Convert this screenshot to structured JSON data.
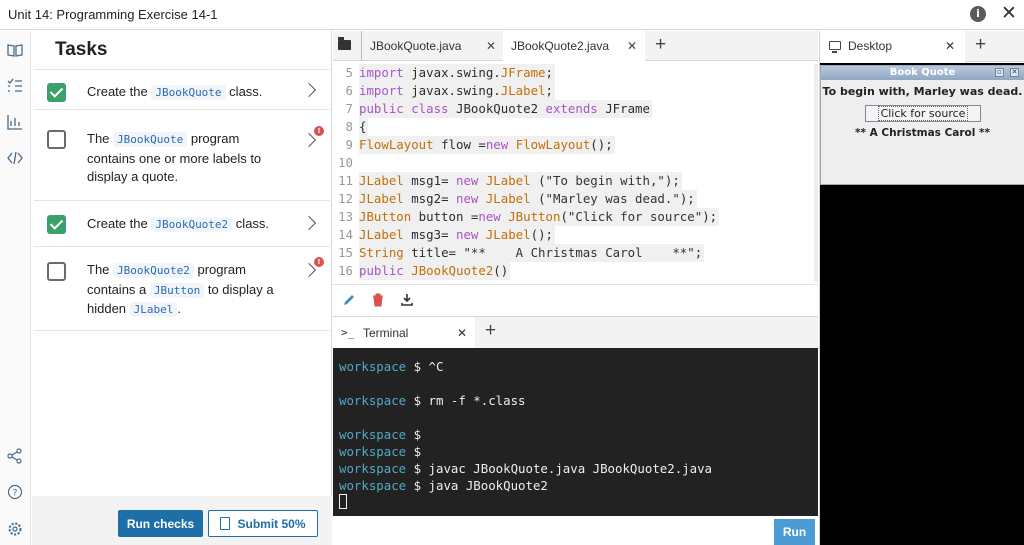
{
  "window": {
    "title": "Unit 14: Programming Exercise 14-1",
    "info_icon": "i",
    "close_icon": "✕"
  },
  "rail": {
    "icons": [
      "book-icon",
      "tasks-icon",
      "chart-icon",
      "code-icon",
      "share-icon",
      "help-icon",
      "settings-icon"
    ]
  },
  "tasks": {
    "heading": "Tasks",
    "items": [
      {
        "checked": true,
        "pre": "Create the ",
        "code1": "JBookQuote",
        "post": " class."
      },
      {
        "checked": false,
        "pre": "The ",
        "code1": "JBookQuote",
        "post": " program contains one or more labels to display a quote.",
        "badge": "!"
      },
      {
        "checked": true,
        "pre": "Create the ",
        "code1": "JBookQuote2",
        "post": " class."
      },
      {
        "checked": false,
        "pre": "The ",
        "code1": "JBookQuote2",
        "mid": " program contains a ",
        "code2": "JButton",
        "mid2": " to display a hidden ",
        "code3": "JLabel",
        "post": ".",
        "badge": "!"
      }
    ],
    "run_checks": "Run checks",
    "submit": "Submit 50%"
  },
  "editor": {
    "tabs": [
      {
        "label": "JBookQuote.java",
        "active": false
      },
      {
        "label": "JBookQuote2.java",
        "active": true
      }
    ],
    "lines": [
      {
        "n": "5",
        "html": "<span class='kw'>import</span><span class='pl'> javax.swing.</span><span class='ty'>JFrame</span><span class='pl'>;</span>"
      },
      {
        "n": "6",
        "html": "<span class='kw'>import</span><span class='pl'> javax.swing.</span><span class='ty'>JLabel</span><span class='pl'>;</span>"
      },
      {
        "n": "7",
        "html": "<span class='kw'>public class</span><span class='pl'> JBookQuote2 </span><span class='kw'>extends</span><span class='pl'> JFrame</span>"
      },
      {
        "n": "8",
        "html": "<span class='pl'>{</span>"
      },
      {
        "n": "9",
        "html": "<span class='ty'>FlowLayout</span><span class='pl'> flow =</span><span class='kw'>new</span><span class='pl'> </span><span class='ty'>FlowLayout</span><span class='pl'>();</span>"
      },
      {
        "n": "10",
        "html": ""
      },
      {
        "n": "11",
        "html": "<span class='ty'>JLabel</span><span class='pl'> msg1= </span><span class='kw'>new</span><span class='pl'> </span><span class='ty'>JLabel</span><span class='pl'> (</span><span class='st'>\"To begin with,\"</span><span class='pl'>);</span>"
      },
      {
        "n": "12",
        "html": "<span class='ty'>JLabel</span><span class='pl'> msg2= </span><span class='kw'>new</span><span class='pl'> </span><span class='ty'>JLabel</span><span class='pl'> (</span><span class='st'>\"Marley was dead.\"</span><span class='pl'>);</span>"
      },
      {
        "n": "13",
        "html": "<span class='ty'>JButton</span><span class='pl'> button =</span><span class='kw'>new</span><span class='pl'> </span><span class='ty'>JButton</span><span class='pl'>(</span><span class='st'>\"Click for source\"</span><span class='pl'>);</span>"
      },
      {
        "n": "14",
        "html": "<span class='ty'>JLabel</span><span class='pl'> msg3= </span><span class='kw'>new</span><span class='pl'> </span><span class='ty'>JLabel</span><span class='pl'>();</span>"
      },
      {
        "n": "15",
        "html": "<span class='ty'>String</span><span class='pl'> title= </span><span class='st'>\"**    A Christmas Carol    **\"</span><span class='pl'>;</span>"
      },
      {
        "n": "16",
        "html": "<span class='kw'>public</span><span class='pl'> </span><span class='ty'>JBookQuote2</span><span class='pl'>()</span>"
      }
    ]
  },
  "terminal": {
    "tab_label": "Terminal",
    "prompt": "workspace",
    "lines": [
      "$ ^C",
      "",
      "$ rm -f *.class",
      "",
      "$",
      "$",
      "$ javac JBookQuote.java JBookQuote2.java",
      "$ java JBookQuote2"
    ],
    "run_label": "Run"
  },
  "desktop": {
    "tab_label": "Desktop",
    "app": {
      "title": "Book Quote",
      "label1": "To begin with, Marley was dead.",
      "button": "Click for source",
      "label2": "** A Christmas Carol **"
    }
  }
}
